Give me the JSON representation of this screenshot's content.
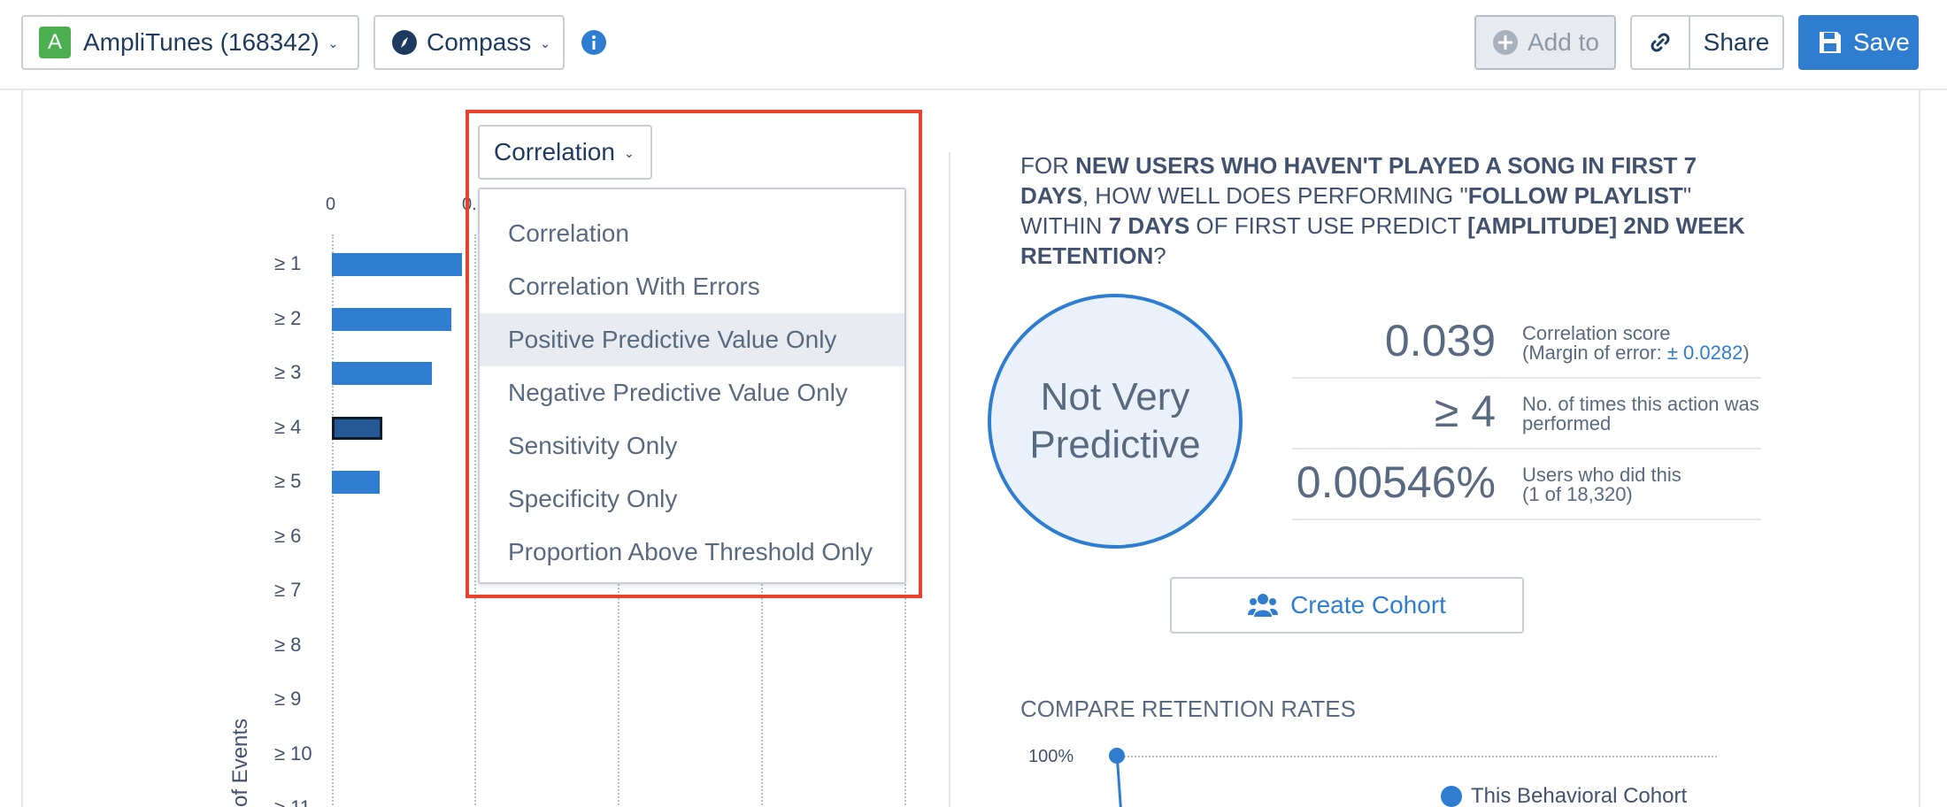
{
  "header": {
    "app_badge": "A",
    "app_label": "AmpliTunes (168342)",
    "compass_label": "Compass",
    "add_to_label": "Add to",
    "share_label": "Share",
    "save_label": "Save"
  },
  "metric_select": {
    "selected": "Correlation",
    "options": [
      "Correlation",
      "Correlation With Errors",
      "Positive Predictive Value Only",
      "Negative Predictive Value Only",
      "Sensitivity Only",
      "Specificity Only",
      "Proportion Above Threshold Only"
    ],
    "hovered_index": 2
  },
  "chart_data": {
    "type": "bar",
    "orientation": "horizontal",
    "x_tick_labels": [
      "0",
      "0."
    ],
    "categories": [
      "≥ 1",
      "≥ 2",
      "≥ 3",
      "≥ 4",
      "≥ 5",
      "≥ 6",
      "≥ 7",
      "≥ 8",
      "≥ 9",
      "≥ 10",
      "≥ 11"
    ],
    "values": [
      0.1,
      0.092,
      0.077,
      0.039,
      0.037,
      0,
      0,
      0,
      0,
      0,
      0
    ],
    "selected_category": "≥ 4",
    "ylabel": "of Events",
    "grid": true
  },
  "question": {
    "p1": "For ",
    "b1": "new users who haven't played a song in first 7 days",
    "p2": ", how well does performing \"",
    "b2": "Follow Playlist",
    "p3": "\" within ",
    "b3": "7 days",
    "p4": " of first use predict ",
    "b4": "[Amplitude] 2nd Week Retention",
    "p5": "?"
  },
  "verdict": {
    "line1": "Not Very",
    "line2": "Predictive"
  },
  "stats": [
    {
      "value": "0.039",
      "label_a": "Correlation score",
      "label_b": "(Margin of error: ",
      "label_link": "± 0.0282",
      "label_c": ")"
    },
    {
      "value": "≥ 4",
      "label_a": "No. of times this action was performed"
    },
    {
      "value": "0.00546%",
      "label_a": "Users who did this",
      "label_b": "(1 of 18,320)"
    }
  ],
  "create_cohort_label": "Create Cohort",
  "compare": {
    "title": "COMPARE RETENTION RATES",
    "y_top_label": "100%",
    "legend_label": "This Behavioral Cohort"
  },
  "colors": {
    "accent": "#2f7dd1",
    "highlight": "#e8432a",
    "app_badge": "#4caf50"
  }
}
